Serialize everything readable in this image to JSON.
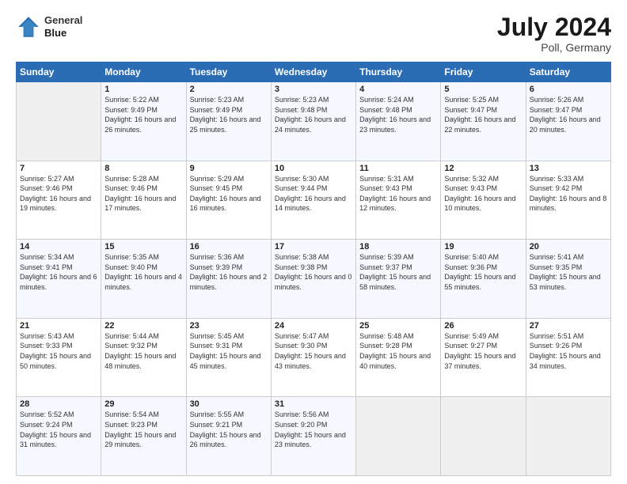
{
  "header": {
    "logo_line1": "General",
    "logo_line2": "Blue",
    "month_year": "July 2024",
    "location": "Poll, Germany"
  },
  "days_of_week": [
    "Sunday",
    "Monday",
    "Tuesday",
    "Wednesday",
    "Thursday",
    "Friday",
    "Saturday"
  ],
  "weeks": [
    [
      {
        "day": "",
        "empty": true
      },
      {
        "day": "1",
        "sunrise": "Sunrise: 5:22 AM",
        "sunset": "Sunset: 9:49 PM",
        "daylight": "Daylight: 16 hours and 26 minutes."
      },
      {
        "day": "2",
        "sunrise": "Sunrise: 5:23 AM",
        "sunset": "Sunset: 9:49 PM",
        "daylight": "Daylight: 16 hours and 25 minutes."
      },
      {
        "day": "3",
        "sunrise": "Sunrise: 5:23 AM",
        "sunset": "Sunset: 9:48 PM",
        "daylight": "Daylight: 16 hours and 24 minutes."
      },
      {
        "day": "4",
        "sunrise": "Sunrise: 5:24 AM",
        "sunset": "Sunset: 9:48 PM",
        "daylight": "Daylight: 16 hours and 23 minutes."
      },
      {
        "day": "5",
        "sunrise": "Sunrise: 5:25 AM",
        "sunset": "Sunset: 9:47 PM",
        "daylight": "Daylight: 16 hours and 22 minutes."
      },
      {
        "day": "6",
        "sunrise": "Sunrise: 5:26 AM",
        "sunset": "Sunset: 9:47 PM",
        "daylight": "Daylight: 16 hours and 20 minutes."
      }
    ],
    [
      {
        "day": "7",
        "sunrise": "Sunrise: 5:27 AM",
        "sunset": "Sunset: 9:46 PM",
        "daylight": "Daylight: 16 hours and 19 minutes."
      },
      {
        "day": "8",
        "sunrise": "Sunrise: 5:28 AM",
        "sunset": "Sunset: 9:46 PM",
        "daylight": "Daylight: 16 hours and 17 minutes."
      },
      {
        "day": "9",
        "sunrise": "Sunrise: 5:29 AM",
        "sunset": "Sunset: 9:45 PM",
        "daylight": "Daylight: 16 hours and 16 minutes."
      },
      {
        "day": "10",
        "sunrise": "Sunrise: 5:30 AM",
        "sunset": "Sunset: 9:44 PM",
        "daylight": "Daylight: 16 hours and 14 minutes."
      },
      {
        "day": "11",
        "sunrise": "Sunrise: 5:31 AM",
        "sunset": "Sunset: 9:43 PM",
        "daylight": "Daylight: 16 hours and 12 minutes."
      },
      {
        "day": "12",
        "sunrise": "Sunrise: 5:32 AM",
        "sunset": "Sunset: 9:43 PM",
        "daylight": "Daylight: 16 hours and 10 minutes."
      },
      {
        "day": "13",
        "sunrise": "Sunrise: 5:33 AM",
        "sunset": "Sunset: 9:42 PM",
        "daylight": "Daylight: 16 hours and 8 minutes."
      }
    ],
    [
      {
        "day": "14",
        "sunrise": "Sunrise: 5:34 AM",
        "sunset": "Sunset: 9:41 PM",
        "daylight": "Daylight: 16 hours and 6 minutes."
      },
      {
        "day": "15",
        "sunrise": "Sunrise: 5:35 AM",
        "sunset": "Sunset: 9:40 PM",
        "daylight": "Daylight: 16 hours and 4 minutes."
      },
      {
        "day": "16",
        "sunrise": "Sunrise: 5:36 AM",
        "sunset": "Sunset: 9:39 PM",
        "daylight": "Daylight: 16 hours and 2 minutes."
      },
      {
        "day": "17",
        "sunrise": "Sunrise: 5:38 AM",
        "sunset": "Sunset: 9:38 PM",
        "daylight": "Daylight: 16 hours and 0 minutes."
      },
      {
        "day": "18",
        "sunrise": "Sunrise: 5:39 AM",
        "sunset": "Sunset: 9:37 PM",
        "daylight": "Daylight: 15 hours and 58 minutes."
      },
      {
        "day": "19",
        "sunrise": "Sunrise: 5:40 AM",
        "sunset": "Sunset: 9:36 PM",
        "daylight": "Daylight: 15 hours and 55 minutes."
      },
      {
        "day": "20",
        "sunrise": "Sunrise: 5:41 AM",
        "sunset": "Sunset: 9:35 PM",
        "daylight": "Daylight: 15 hours and 53 minutes."
      }
    ],
    [
      {
        "day": "21",
        "sunrise": "Sunrise: 5:43 AM",
        "sunset": "Sunset: 9:33 PM",
        "daylight": "Daylight: 15 hours and 50 minutes."
      },
      {
        "day": "22",
        "sunrise": "Sunrise: 5:44 AM",
        "sunset": "Sunset: 9:32 PM",
        "daylight": "Daylight: 15 hours and 48 minutes."
      },
      {
        "day": "23",
        "sunrise": "Sunrise: 5:45 AM",
        "sunset": "Sunset: 9:31 PM",
        "daylight": "Daylight: 15 hours and 45 minutes."
      },
      {
        "day": "24",
        "sunrise": "Sunrise: 5:47 AM",
        "sunset": "Sunset: 9:30 PM",
        "daylight": "Daylight: 15 hours and 43 minutes."
      },
      {
        "day": "25",
        "sunrise": "Sunrise: 5:48 AM",
        "sunset": "Sunset: 9:28 PM",
        "daylight": "Daylight: 15 hours and 40 minutes."
      },
      {
        "day": "26",
        "sunrise": "Sunrise: 5:49 AM",
        "sunset": "Sunset: 9:27 PM",
        "daylight": "Daylight: 15 hours and 37 minutes."
      },
      {
        "day": "27",
        "sunrise": "Sunrise: 5:51 AM",
        "sunset": "Sunset: 9:26 PM",
        "daylight": "Daylight: 15 hours and 34 minutes."
      }
    ],
    [
      {
        "day": "28",
        "sunrise": "Sunrise: 5:52 AM",
        "sunset": "Sunset: 9:24 PM",
        "daylight": "Daylight: 15 hours and 31 minutes."
      },
      {
        "day": "29",
        "sunrise": "Sunrise: 5:54 AM",
        "sunset": "Sunset: 9:23 PM",
        "daylight": "Daylight: 15 hours and 29 minutes."
      },
      {
        "day": "30",
        "sunrise": "Sunrise: 5:55 AM",
        "sunset": "Sunset: 9:21 PM",
        "daylight": "Daylight: 15 hours and 26 minutes."
      },
      {
        "day": "31",
        "sunrise": "Sunrise: 5:56 AM",
        "sunset": "Sunset: 9:20 PM",
        "daylight": "Daylight: 15 hours and 23 minutes."
      },
      {
        "day": "",
        "empty": true
      },
      {
        "day": "",
        "empty": true
      },
      {
        "day": "",
        "empty": true
      }
    ]
  ]
}
